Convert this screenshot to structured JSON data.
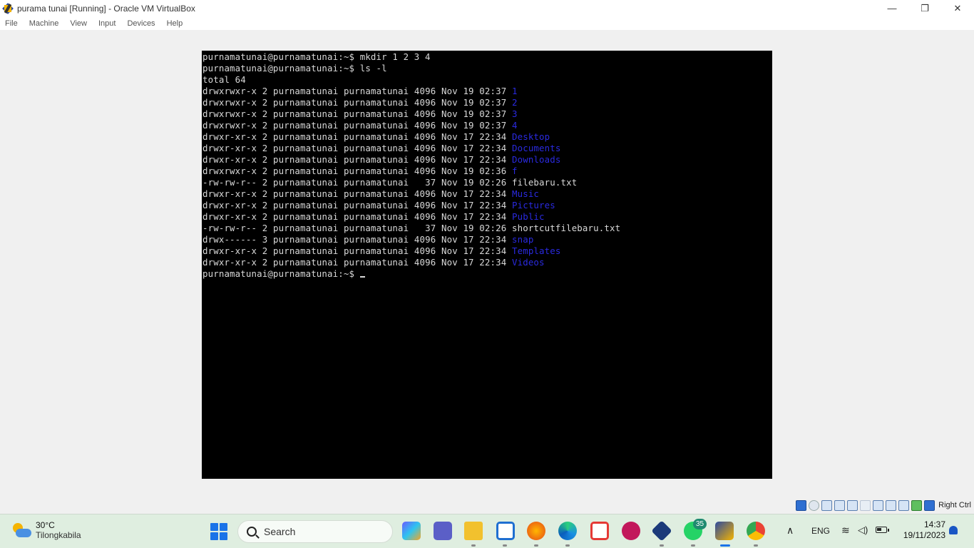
{
  "window": {
    "title": "purama tunai [Running] - Oracle VM VirtualBox",
    "minimize_glyph": "—",
    "maximize_glyph": "❐",
    "close_glyph": "✕"
  },
  "menu": {
    "items": [
      "File",
      "Machine",
      "View",
      "Input",
      "Devices",
      "Help"
    ]
  },
  "terminal": {
    "prompt": "purnamatunai@purnamatunai:~$",
    "commands": [
      "mkdir 1 2 3 4",
      "ls -l"
    ],
    "total": "total 64",
    "entries": [
      {
        "perm": "drwxrwxr-x",
        "links": "2",
        "owner": "purnamatunai",
        "group": "purnamatunai",
        "size": "4096",
        "month": "Nov",
        "day": "19",
        "time": "02:37",
        "name": "1",
        "type": "dir"
      },
      {
        "perm": "drwxrwxr-x",
        "links": "2",
        "owner": "purnamatunai",
        "group": "purnamatunai",
        "size": "4096",
        "month": "Nov",
        "day": "19",
        "time": "02:37",
        "name": "2",
        "type": "dir"
      },
      {
        "perm": "drwxrwxr-x",
        "links": "2",
        "owner": "purnamatunai",
        "group": "purnamatunai",
        "size": "4096",
        "month": "Nov",
        "day": "19",
        "time": "02:37",
        "name": "3",
        "type": "dir"
      },
      {
        "perm": "drwxrwxr-x",
        "links": "2",
        "owner": "purnamatunai",
        "group": "purnamatunai",
        "size": "4096",
        "month": "Nov",
        "day": "19",
        "time": "02:37",
        "name": "4",
        "type": "dir"
      },
      {
        "perm": "drwxr-xr-x",
        "links": "2",
        "owner": "purnamatunai",
        "group": "purnamatunai",
        "size": "4096",
        "month": "Nov",
        "day": "17",
        "time": "22:34",
        "name": "Desktop",
        "type": "dir"
      },
      {
        "perm": "drwxr-xr-x",
        "links": "2",
        "owner": "purnamatunai",
        "group": "purnamatunai",
        "size": "4096",
        "month": "Nov",
        "day": "17",
        "time": "22:34",
        "name": "Documents",
        "type": "dir"
      },
      {
        "perm": "drwxr-xr-x",
        "links": "2",
        "owner": "purnamatunai",
        "group": "purnamatunai",
        "size": "4096",
        "month": "Nov",
        "day": "17",
        "time": "22:34",
        "name": "Downloads",
        "type": "dir"
      },
      {
        "perm": "drwxrwxr-x",
        "links": "2",
        "owner": "purnamatunai",
        "group": "purnamatunai",
        "size": "4096",
        "month": "Nov",
        "day": "19",
        "time": "02:36",
        "name": "f",
        "type": "dir"
      },
      {
        "perm": "-rw-rw-r--",
        "links": "2",
        "owner": "purnamatunai",
        "group": "purnamatunai",
        "size": "37",
        "month": "Nov",
        "day": "19",
        "time": "02:26",
        "name": "filebaru.txt",
        "type": "file"
      },
      {
        "perm": "drwxr-xr-x",
        "links": "2",
        "owner": "purnamatunai",
        "group": "purnamatunai",
        "size": "4096",
        "month": "Nov",
        "day": "17",
        "time": "22:34",
        "name": "Music",
        "type": "dir"
      },
      {
        "perm": "drwxr-xr-x",
        "links": "2",
        "owner": "purnamatunai",
        "group": "purnamatunai",
        "size": "4096",
        "month": "Nov",
        "day": "17",
        "time": "22:34",
        "name": "Pictures",
        "type": "dir"
      },
      {
        "perm": "drwxr-xr-x",
        "links": "2",
        "owner": "purnamatunai",
        "group": "purnamatunai",
        "size": "4096",
        "month": "Nov",
        "day": "17",
        "time": "22:34",
        "name": "Public",
        "type": "dir"
      },
      {
        "perm": "-rw-rw-r--",
        "links": "2",
        "owner": "purnamatunai",
        "group": "purnamatunai",
        "size": "37",
        "month": "Nov",
        "day": "19",
        "time": "02:26",
        "name": "shortcutfilebaru.txt",
        "type": "file"
      },
      {
        "perm": "drwx------",
        "links": "3",
        "owner": "purnamatunai",
        "group": "purnamatunai",
        "size": "4096",
        "month": "Nov",
        "day": "17",
        "time": "22:34",
        "name": "snap",
        "type": "dir"
      },
      {
        "perm": "drwxr-xr-x",
        "links": "2",
        "owner": "purnamatunai",
        "group": "purnamatunai",
        "size": "4096",
        "month": "Nov",
        "day": "17",
        "time": "22:34",
        "name": "Templates",
        "type": "dir"
      },
      {
        "perm": "drwxr-xr-x",
        "links": "2",
        "owner": "purnamatunai",
        "group": "purnamatunai",
        "size": "4096",
        "month": "Nov",
        "day": "17",
        "time": "22:34",
        "name": "Videos",
        "type": "dir"
      }
    ],
    "colors": {
      "background": "#000000",
      "text": "#d8d8d8",
      "directory": "#2a2ae0"
    }
  },
  "statusbar": {
    "host_key_label": "Right Ctrl",
    "icons": [
      "hard-disk-icon",
      "optical-drive-icon",
      "audio-icon",
      "network-icon",
      "usb-icon",
      "shared-folders-icon",
      "display-icon",
      "recording-icon",
      "cpu-icon",
      "mouse-integration-icon",
      "keyboard-icon"
    ]
  },
  "taskbar": {
    "weather": {
      "temp": "30°C",
      "location": "Tilongkabila"
    },
    "search_label": "Search",
    "apps": [
      "start-icon",
      "copilot-icon",
      "teams-icon",
      "file-explorer-icon",
      "vscode-icon",
      "firefox-icon",
      "edge-icon",
      "snipping-tool-icon",
      "wps-office-icon",
      "virtualbox-icon",
      "whatsapp-icon",
      "virtualbox-vm-icon",
      "chrome-icon"
    ],
    "whatsapp_badge": "35",
    "language": "ENG",
    "time": "14:37",
    "date": "19/11/2023"
  }
}
